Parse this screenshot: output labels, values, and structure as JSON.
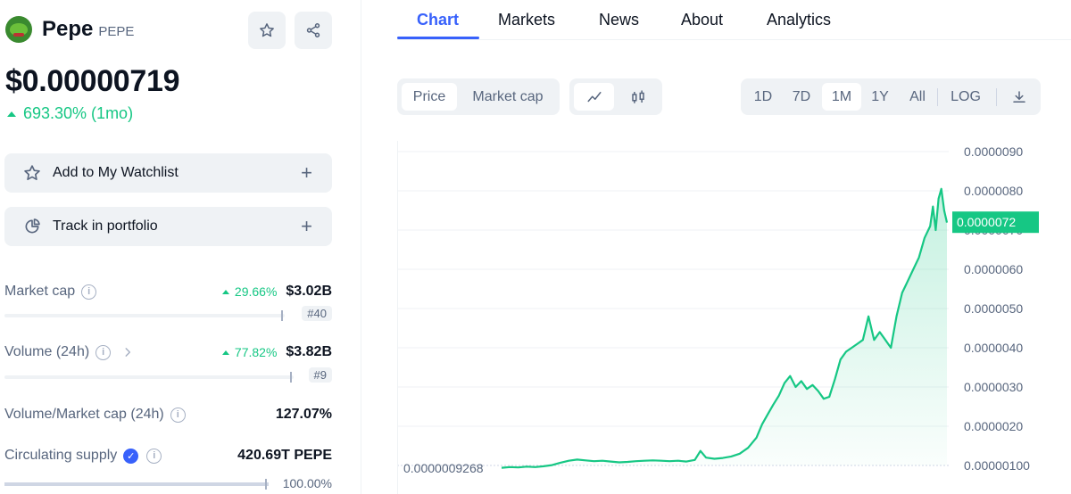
{
  "coin": {
    "name": "Pepe",
    "symbol": "PEPE",
    "price": "$0.00000719",
    "change": "693.30% (1mo)",
    "change_color": "#16c784"
  },
  "actions": {
    "star_icon": "star-icon",
    "share_icon": "share-icon",
    "watchlist_label": "Add to My Watchlist",
    "portfolio_label": "Track in portfolio",
    "plus": "+"
  },
  "stats": [
    {
      "label": "Market cap",
      "change": "29.66%",
      "value": "$3.02B",
      "rank": "#40"
    },
    {
      "label": "Volume (24h)",
      "change": "77.82%",
      "value": "$3.82B",
      "rank": "#9"
    },
    {
      "label": "Volume/Market cap (24h)",
      "value": "127.07%"
    },
    {
      "label": "Circulating supply",
      "value": "420.69T PEPE",
      "percent": "100.00%",
      "fill": 1.0
    }
  ],
  "tabs": [
    "Chart",
    "Markets",
    "News",
    "About",
    "Analytics"
  ],
  "controls": {
    "data_toggle": [
      "Price",
      "Market cap"
    ],
    "ranges": [
      "1D",
      "7D",
      "1M",
      "1Y",
      "All"
    ],
    "log": "LOG",
    "selected_range": "1M"
  },
  "chart_data": {
    "type": "area",
    "series": [
      {
        "color": "#16c784",
        "points": [
          [
            0,
            9.4e-07
          ],
          [
            3,
            9.6e-07
          ],
          [
            6,
            9.5e-07
          ],
          [
            9,
            9.7e-07
          ],
          [
            12,
            9.6e-07
          ],
          [
            15,
            9.8e-07
          ],
          [
            18,
            1.01e-06
          ],
          [
            21,
            1.07e-06
          ],
          [
            24,
            1.12e-06
          ],
          [
            27,
            1.15e-06
          ],
          [
            30,
            1.13e-06
          ],
          [
            33,
            1.11e-06
          ],
          [
            36,
            1.12e-06
          ],
          [
            39,
            1.1e-06
          ],
          [
            42,
            1.08e-06
          ],
          [
            45,
            1.09e-06
          ],
          [
            48,
            1.11e-06
          ],
          [
            51,
            1.12e-06
          ],
          [
            54,
            1.13e-06
          ],
          [
            57,
            1.12e-06
          ],
          [
            60,
            1.11e-06
          ],
          [
            63,
            1.12e-06
          ],
          [
            66,
            1.1e-06
          ],
          [
            69,
            1.14e-06
          ],
          [
            71,
            1.37e-06
          ],
          [
            73,
            1.2e-06
          ],
          [
            76,
            1.17e-06
          ],
          [
            79,
            1.19e-06
          ],
          [
            82,
            1.23e-06
          ],
          [
            85,
            1.3e-06
          ],
          [
            88,
            1.45e-06
          ],
          [
            91,
            1.71e-06
          ],
          [
            93,
            2.05e-06
          ],
          [
            95,
            2.3e-06
          ],
          [
            97,
            2.55e-06
          ],
          [
            99,
            2.78e-06
          ],
          [
            101,
            3.1e-06
          ],
          [
            103,
            3.28e-06
          ],
          [
            105,
            3e-06
          ],
          [
            107,
            3.15e-06
          ],
          [
            109,
            2.95e-06
          ],
          [
            111,
            3.05e-06
          ],
          [
            113,
            2.9e-06
          ],
          [
            115,
            2.7e-06
          ],
          [
            117,
            2.75e-06
          ],
          [
            119,
            3.2e-06
          ],
          [
            121,
            3.7e-06
          ],
          [
            123,
            3.9e-06
          ],
          [
            125,
            4e-06
          ],
          [
            127,
            4.1e-06
          ],
          [
            129,
            4.2e-06
          ],
          [
            131,
            4.8e-06
          ],
          [
            133,
            4.2e-06
          ],
          [
            135,
            4.4e-06
          ],
          [
            137,
            4.2e-06
          ],
          [
            139,
            4e-06
          ],
          [
            141,
            4.8e-06
          ],
          [
            143,
            5.4e-06
          ],
          [
            145,
            5.7e-06
          ],
          [
            147,
            6e-06
          ],
          [
            149,
            6.3e-06
          ],
          [
            151,
            6.8e-06
          ],
          [
            153,
            7.1e-06
          ],
          [
            154,
            7.6e-06
          ],
          [
            155,
            7e-06
          ],
          [
            156,
            7.8e-06
          ],
          [
            157,
            8.05e-06
          ],
          [
            158,
            7.5e-06
          ],
          [
            159,
            7.19e-06
          ]
        ],
        "x_max": 159
      }
    ],
    "ylim": [
      9e-07,
      9e-06
    ],
    "y_ticks": [
      "0.0000090",
      "0.0000080",
      "0.0000070",
      "0.0000060",
      "0.0000050",
      "0.0000040",
      "0.0000030",
      "0.0000020",
      "0.00000100"
    ],
    "y_tick_values": [
      9e-06,
      8e-06,
      7e-06,
      6e-06,
      5e-06,
      4e-06,
      3e-06,
      2e-06,
      1e-06
    ],
    "min_label": "0.0000009268",
    "current_label": "0.0000072",
    "current_value": 7.2e-06,
    "grid": true
  }
}
